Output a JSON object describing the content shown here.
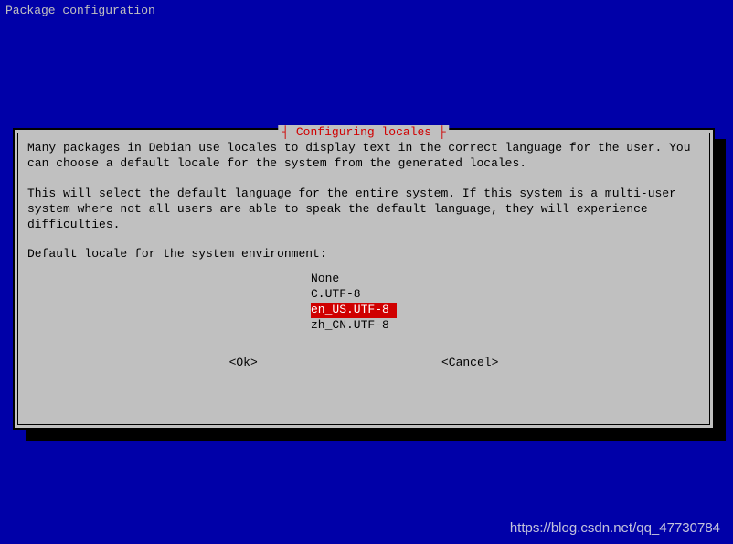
{
  "header": "Package configuration",
  "dialog": {
    "title": "┤ Configuring locales ├",
    "para1": "Many packages in Debian use locales to display text in the correct language for the user. You can choose a default locale for the system from the generated locales.",
    "para2": "This will select the default language for the entire system. If this system is a multi-user system where not all users are able to speak the default language, they will experience difficulties.",
    "prompt": "Default locale for the system environment:",
    "options": [
      "None",
      "C.UTF-8",
      "en_US.UTF-8",
      "zh_CN.UTF-8"
    ],
    "selected_index": 2,
    "ok_label": "<Ok>",
    "cancel_label": "<Cancel>"
  },
  "watermark": "https://blog.csdn.net/qq_47730784"
}
